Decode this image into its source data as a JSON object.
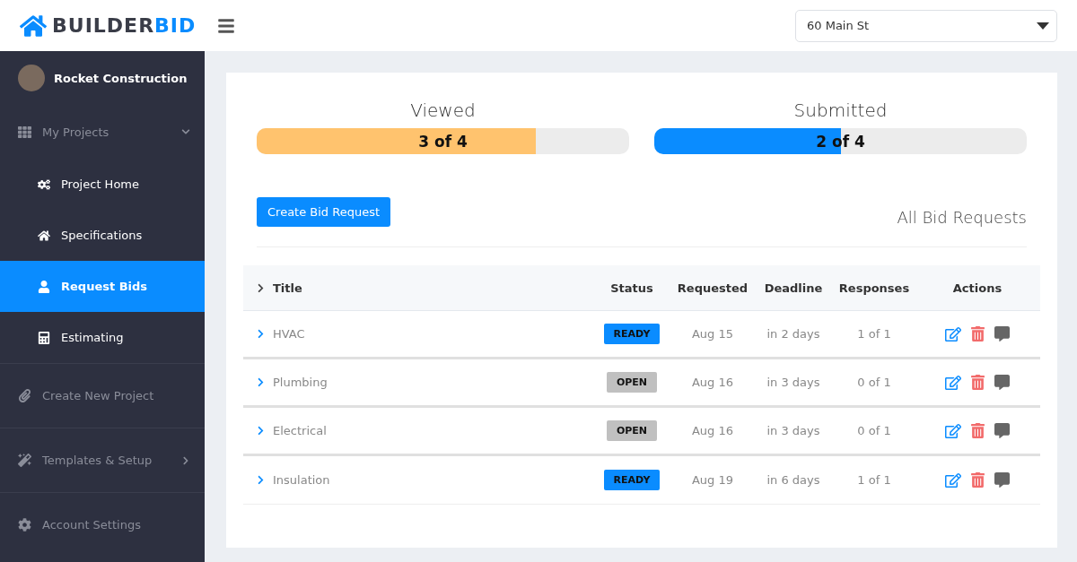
{
  "logo": {
    "part_1": "BUILDER",
    "part_2": "BID"
  },
  "sidebar": {
    "profile": {
      "name": "Rocket Construction"
    },
    "items": [
      {
        "label": "My Projects",
        "expanded": true,
        "selected": false,
        "children": [
          {
            "label": "Project Home",
            "selected": false
          },
          {
            "label": "Specifications",
            "selected": false
          },
          {
            "label": "Request Bids",
            "selected": true
          },
          {
            "label": "Estimating",
            "selected": false
          }
        ]
      },
      {
        "label": "Create New Project",
        "selected": false
      },
      {
        "label": "Templates & Setup",
        "expanded": false,
        "selected": false
      },
      {
        "label": "Account Settings",
        "selected": false
      }
    ]
  },
  "project_select": {
    "value": "60 Main St"
  },
  "progress": [
    {
      "title": "Viewed",
      "reading": "3 of 4",
      "level": 0.75,
      "color": "#ffc36e"
    },
    {
      "title": "Submitted",
      "reading": "2 of 4",
      "level": 0.5,
      "color": "#0a8cff"
    }
  ],
  "create_button": "Create Bid Request",
  "list_title": "All Bid Requests",
  "table": {
    "columns": [
      "Title",
      "Status",
      "Requested",
      "Deadline",
      "Responses",
      "Actions"
    ],
    "rows": [
      {
        "title": "HVAC",
        "status": "READY",
        "kind": "ready",
        "requested": "Aug 15",
        "deadline": "in 2 days",
        "responses": "1 of 1"
      },
      {
        "title": "Plumbing",
        "status": "OPEN",
        "kind": "open",
        "requested": "Aug 16",
        "deadline": "in 3 days",
        "responses": "0 of 1"
      },
      {
        "title": "Electrical",
        "status": "OPEN",
        "kind": "open",
        "requested": "Aug 16",
        "deadline": "in 3 days",
        "responses": "0 of 1"
      },
      {
        "title": "Insulation",
        "status": "READY",
        "kind": "ready",
        "requested": "Aug 19",
        "deadline": "in 6 days",
        "responses": "1 of 1"
      }
    ]
  }
}
